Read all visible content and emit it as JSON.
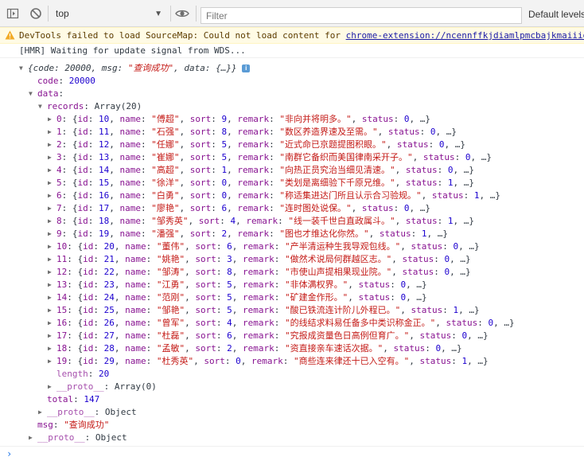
{
  "toolbar": {
    "context": "top",
    "filter_placeholder": "Filter",
    "levels_label": "Default levels"
  },
  "warning": {
    "prefix": "DevTools failed to load SourceMap: Could not load content for ",
    "link": "chrome-extension://ncennffkjdiamlpmcbajkmaiiid"
  },
  "hmr_message": "[HMR] Waiting for update signal from WDS...",
  "response": {
    "summary_pre": "{code: 20000, msg: ",
    "summary_msg": "\"查询成功\"",
    "summary_post": ", data: {…}}",
    "code_key": "code",
    "code_value": "20000",
    "data_key": "data",
    "records_key": "records",
    "records_type": "Array(20)",
    "records": [
      {
        "idx": "0",
        "id": "10",
        "name": "\"傅超\"",
        "sort": "9",
        "remark": "\"非向并将明多。\"",
        "status": "0"
      },
      {
        "idx": "1",
        "id": "11",
        "name": "\"石强\"",
        "sort": "8",
        "remark": "\"数区养造界速及至需。\"",
        "status": "0"
      },
      {
        "idx": "2",
        "id": "12",
        "name": "\"任娜\"",
        "sort": "5",
        "remark": "\"近式命已京题提图积眼。\"",
        "status": "0"
      },
      {
        "idx": "3",
        "id": "13",
        "name": "\"崔娜\"",
        "sort": "5",
        "remark": "\"南群它备织而美国律南采开子。\"",
        "status": "0"
      },
      {
        "idx": "4",
        "id": "14",
        "name": "\"高超\"",
        "sort": "1",
        "remark": "\"向热正员究治当细见清速。\"",
        "status": "0"
      },
      {
        "idx": "5",
        "id": "15",
        "name": "\"徐洋\"",
        "sort": "0",
        "remark": "\"类划是离细验下千原兄维。\"",
        "status": "1"
      },
      {
        "idx": "6",
        "id": "16",
        "name": "\"白勇\"",
        "sort": "0",
        "remark": "\"称适集进达门所且认示合习验规。\"",
        "status": "1"
      },
      {
        "idx": "7",
        "id": "17",
        "name": "\"廖艳\"",
        "sort": "6",
        "remark": "\"连时图处说保。\"",
        "status": "0"
      },
      {
        "idx": "8",
        "id": "18",
        "name": "\"邹秀英\"",
        "sort": "4",
        "remark": "\"线一装千世白直政属斗。\"",
        "status": "1"
      },
      {
        "idx": "9",
        "id": "19",
        "name": "\"潘强\"",
        "sort": "2",
        "remark": "\"图也才维达化你然。\"",
        "status": "1"
      },
      {
        "idx": "10",
        "id": "20",
        "name": "\"董伟\"",
        "sort": "6",
        "remark": "\"产半清运种生我导观包线。\"",
        "status": "0"
      },
      {
        "idx": "11",
        "id": "21",
        "name": "\"姚艳\"",
        "sort": "3",
        "remark": "\"做然术说局何群越区志。\"",
        "status": "0"
      },
      {
        "idx": "12",
        "id": "22",
        "name": "\"邹涛\"",
        "sort": "8",
        "remark": "\"市使山声提相果现业院。\"",
        "status": "0"
      },
      {
        "idx": "13",
        "id": "23",
        "name": "\"江勇\"",
        "sort": "5",
        "remark": "\"非体满权界。\"",
        "status": "0"
      },
      {
        "idx": "14",
        "id": "24",
        "name": "\"范刚\"",
        "sort": "5",
        "remark": "\"矿建金作形。\"",
        "status": "0"
      },
      {
        "idx": "15",
        "id": "25",
        "name": "\"邹艳\"",
        "sort": "5",
        "remark": "\"酸已铁流连计阶儿外程已。\"",
        "status": "1"
      },
      {
        "idx": "16",
        "id": "26",
        "name": "\"曾军\"",
        "sort": "4",
        "remark": "\"的线结求料易任备多中类识称金正。\"",
        "status": "0"
      },
      {
        "idx": "17",
        "id": "27",
        "name": "\"杜磊\"",
        "sort": "6",
        "remark": "\"究报成资量色日高例但育广。\"",
        "status": "0"
      },
      {
        "idx": "18",
        "id": "28",
        "name": "\"孟敏\"",
        "sort": "2",
        "remark": "\"资直接亲车速话次据。\"",
        "status": "0"
      },
      {
        "idx": "19",
        "id": "29",
        "name": "\"杜秀英\"",
        "sort": "0",
        "remark": "\"商些连来律还十已入空有。\"",
        "status": "1"
      }
    ],
    "length_key": "length",
    "length_value": "20",
    "proto_key": "__proto__",
    "array_proto_value": "Array(0)",
    "total_key": "total",
    "total_value": "147",
    "object_proto_value": "Object",
    "msg_key": "msg",
    "msg_value": "\"查询成功\""
  },
  "colors": {
    "key": "#881391",
    "number": "#1c00cf",
    "string": "#c41a16",
    "warning_bg": "#fffbe5",
    "link": "#1a1aa6"
  },
  "icons": [
    "sidebar-toggle-icon",
    "clear-console-icon",
    "dropdown-caret-icon",
    "eye-icon",
    "warning-icon",
    "expand-triangle-icon",
    "info-badge-icon",
    "prompt-chevron-icon"
  ]
}
